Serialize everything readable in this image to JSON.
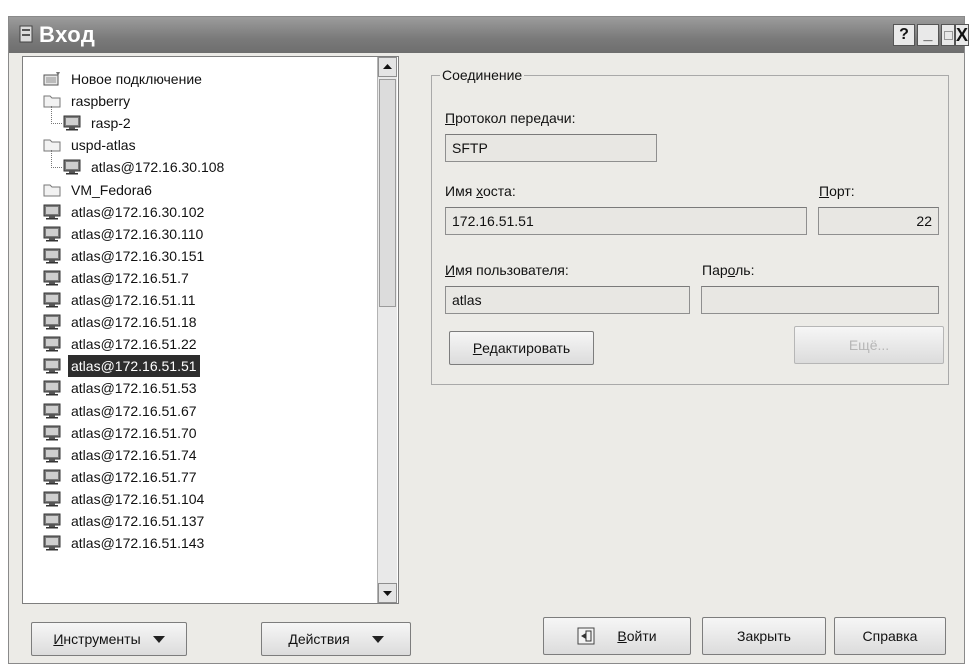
{
  "window": {
    "title": "Вход",
    "help_label": "?",
    "minimize_label": "_",
    "close_label": "X"
  },
  "tree": {
    "items": [
      {
        "label": "Новое подключение",
        "icon": "new-connection-icon",
        "indent": 0
      },
      {
        "label": "raspberry",
        "icon": "folder-icon",
        "indent": 0
      },
      {
        "label": "rasp-2",
        "icon": "computer-icon",
        "indent": 1
      },
      {
        "label": "uspd-atlas",
        "icon": "folder-icon",
        "indent": 0
      },
      {
        "label": "atlas@172.16.30.108",
        "icon": "computer-icon",
        "indent": 1
      },
      {
        "label": "VM_Fedora6",
        "icon": "folder-icon",
        "indent": 0
      },
      {
        "label": "atlas@172.16.30.102",
        "icon": "computer-icon",
        "indent": 0
      },
      {
        "label": "atlas@172.16.30.110",
        "icon": "computer-icon",
        "indent": 0
      },
      {
        "label": "atlas@172.16.30.151",
        "icon": "computer-icon",
        "indent": 0
      },
      {
        "label": "atlas@172.16.51.7",
        "icon": "computer-icon",
        "indent": 0
      },
      {
        "label": "atlas@172.16.51.11",
        "icon": "computer-icon",
        "indent": 0
      },
      {
        "label": "atlas@172.16.51.18",
        "icon": "computer-icon",
        "indent": 0
      },
      {
        "label": "atlas@172.16.51.22",
        "icon": "computer-icon",
        "indent": 0
      },
      {
        "label": "atlas@172.16.51.51",
        "icon": "computer-icon",
        "indent": 0,
        "selected": true
      },
      {
        "label": "atlas@172.16.51.53",
        "icon": "computer-icon",
        "indent": 0
      },
      {
        "label": "atlas@172.16.51.67",
        "icon": "computer-icon",
        "indent": 0
      },
      {
        "label": "atlas@172.16.51.70",
        "icon": "computer-icon",
        "indent": 0
      },
      {
        "label": "atlas@172.16.51.74",
        "icon": "computer-icon",
        "indent": 0
      },
      {
        "label": "atlas@172.16.51.77",
        "icon": "computer-icon",
        "indent": 0
      },
      {
        "label": "atlas@172.16.51.104",
        "icon": "computer-icon",
        "indent": 0
      },
      {
        "label": "atlas@172.16.51.137",
        "icon": "computer-icon",
        "indent": 0
      },
      {
        "label": "atlas@172.16.51.143",
        "icon": "computer-icon",
        "indent": 0
      }
    ]
  },
  "connection": {
    "legend": "Соединение",
    "protocol_label_first": "П",
    "protocol_label_rest": "ротокол передачи:",
    "protocol_value": "SFTP",
    "host_label_first": "Имя ",
    "host_label_underlined": "х",
    "host_label_rest": "оста:",
    "host_value": "172.16.51.51",
    "port_label_first": "П",
    "port_label_rest": "орт:",
    "port_value": "22",
    "user_label_first": "И",
    "user_label_rest": "мя пользователя:",
    "user_value": "atlas",
    "password_label_first": "Пар",
    "password_label_underlined": "о",
    "password_label_rest": "ль:",
    "password_value": "",
    "edit_label_first": "Р",
    "edit_label_rest": "едактировать",
    "more_label": "Ещё..."
  },
  "footer": {
    "tools_label_first": "И",
    "tools_label_rest": "нструменты",
    "actions_label_first": "Д",
    "actions_label_rest": "ействия",
    "login_label_first": "В",
    "login_label_rest": "ойти",
    "close_label": "Закрыть",
    "help_label": "Справка"
  },
  "colors": {
    "selected_bg": "#2d2d2d",
    "titlebar": "#7a7a7a"
  }
}
